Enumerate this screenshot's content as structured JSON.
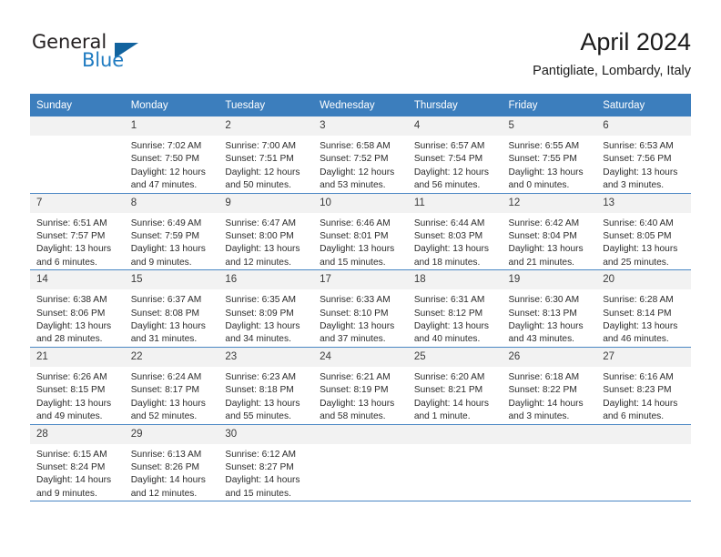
{
  "logo": {
    "word_one": "General",
    "word_two": "Blue",
    "triangle_color": "#12639e",
    "blue_color": "#1f7bc1"
  },
  "header": {
    "title": "April 2024",
    "subtitle": "Pantigliate, Lombardy, Italy"
  },
  "theme": {
    "header_blue": "#3c7ebd",
    "grid_line": "#4a87c4",
    "daynum_bg": "#f2f2f2"
  },
  "columns": [
    "Sunday",
    "Monday",
    "Tuesday",
    "Wednesday",
    "Thursday",
    "Friday",
    "Saturday"
  ],
  "weeks": [
    [
      {
        "day": "",
        "lines": []
      },
      {
        "day": "1",
        "lines": [
          "Sunrise: 7:02 AM",
          "Sunset: 7:50 PM",
          "Daylight: 12 hours",
          "and 47 minutes."
        ]
      },
      {
        "day": "2",
        "lines": [
          "Sunrise: 7:00 AM",
          "Sunset: 7:51 PM",
          "Daylight: 12 hours",
          "and 50 minutes."
        ]
      },
      {
        "day": "3",
        "lines": [
          "Sunrise: 6:58 AM",
          "Sunset: 7:52 PM",
          "Daylight: 12 hours",
          "and 53 minutes."
        ]
      },
      {
        "day": "4",
        "lines": [
          "Sunrise: 6:57 AM",
          "Sunset: 7:54 PM",
          "Daylight: 12 hours",
          "and 56 minutes."
        ]
      },
      {
        "day": "5",
        "lines": [
          "Sunrise: 6:55 AM",
          "Sunset: 7:55 PM",
          "Daylight: 13 hours",
          "and 0 minutes."
        ]
      },
      {
        "day": "6",
        "lines": [
          "Sunrise: 6:53 AM",
          "Sunset: 7:56 PM",
          "Daylight: 13 hours",
          "and 3 minutes."
        ]
      }
    ],
    [
      {
        "day": "7",
        "lines": [
          "Sunrise: 6:51 AM",
          "Sunset: 7:57 PM",
          "Daylight: 13 hours",
          "and 6 minutes."
        ]
      },
      {
        "day": "8",
        "lines": [
          "Sunrise: 6:49 AM",
          "Sunset: 7:59 PM",
          "Daylight: 13 hours",
          "and 9 minutes."
        ]
      },
      {
        "day": "9",
        "lines": [
          "Sunrise: 6:47 AM",
          "Sunset: 8:00 PM",
          "Daylight: 13 hours",
          "and 12 minutes."
        ]
      },
      {
        "day": "10",
        "lines": [
          "Sunrise: 6:46 AM",
          "Sunset: 8:01 PM",
          "Daylight: 13 hours",
          "and 15 minutes."
        ]
      },
      {
        "day": "11",
        "lines": [
          "Sunrise: 6:44 AM",
          "Sunset: 8:03 PM",
          "Daylight: 13 hours",
          "and 18 minutes."
        ]
      },
      {
        "day": "12",
        "lines": [
          "Sunrise: 6:42 AM",
          "Sunset: 8:04 PM",
          "Daylight: 13 hours",
          "and 21 minutes."
        ]
      },
      {
        "day": "13",
        "lines": [
          "Sunrise: 6:40 AM",
          "Sunset: 8:05 PM",
          "Daylight: 13 hours",
          "and 25 minutes."
        ]
      }
    ],
    [
      {
        "day": "14",
        "lines": [
          "Sunrise: 6:38 AM",
          "Sunset: 8:06 PM",
          "Daylight: 13 hours",
          "and 28 minutes."
        ]
      },
      {
        "day": "15",
        "lines": [
          "Sunrise: 6:37 AM",
          "Sunset: 8:08 PM",
          "Daylight: 13 hours",
          "and 31 minutes."
        ]
      },
      {
        "day": "16",
        "lines": [
          "Sunrise: 6:35 AM",
          "Sunset: 8:09 PM",
          "Daylight: 13 hours",
          "and 34 minutes."
        ]
      },
      {
        "day": "17",
        "lines": [
          "Sunrise: 6:33 AM",
          "Sunset: 8:10 PM",
          "Daylight: 13 hours",
          "and 37 minutes."
        ]
      },
      {
        "day": "18",
        "lines": [
          "Sunrise: 6:31 AM",
          "Sunset: 8:12 PM",
          "Daylight: 13 hours",
          "and 40 minutes."
        ]
      },
      {
        "day": "19",
        "lines": [
          "Sunrise: 6:30 AM",
          "Sunset: 8:13 PM",
          "Daylight: 13 hours",
          "and 43 minutes."
        ]
      },
      {
        "day": "20",
        "lines": [
          "Sunrise: 6:28 AM",
          "Sunset: 8:14 PM",
          "Daylight: 13 hours",
          "and 46 minutes."
        ]
      }
    ],
    [
      {
        "day": "21",
        "lines": [
          "Sunrise: 6:26 AM",
          "Sunset: 8:15 PM",
          "Daylight: 13 hours",
          "and 49 minutes."
        ]
      },
      {
        "day": "22",
        "lines": [
          "Sunrise: 6:24 AM",
          "Sunset: 8:17 PM",
          "Daylight: 13 hours",
          "and 52 minutes."
        ]
      },
      {
        "day": "23",
        "lines": [
          "Sunrise: 6:23 AM",
          "Sunset: 8:18 PM",
          "Daylight: 13 hours",
          "and 55 minutes."
        ]
      },
      {
        "day": "24",
        "lines": [
          "Sunrise: 6:21 AM",
          "Sunset: 8:19 PM",
          "Daylight: 13 hours",
          "and 58 minutes."
        ]
      },
      {
        "day": "25",
        "lines": [
          "Sunrise: 6:20 AM",
          "Sunset: 8:21 PM",
          "Daylight: 14 hours",
          "and 1 minute."
        ]
      },
      {
        "day": "26",
        "lines": [
          "Sunrise: 6:18 AM",
          "Sunset: 8:22 PM",
          "Daylight: 14 hours",
          "and 3 minutes."
        ]
      },
      {
        "day": "27",
        "lines": [
          "Sunrise: 6:16 AM",
          "Sunset: 8:23 PM",
          "Daylight: 14 hours",
          "and 6 minutes."
        ]
      }
    ],
    [
      {
        "day": "28",
        "lines": [
          "Sunrise: 6:15 AM",
          "Sunset: 8:24 PM",
          "Daylight: 14 hours",
          "and 9 minutes."
        ]
      },
      {
        "day": "29",
        "lines": [
          "Sunrise: 6:13 AM",
          "Sunset: 8:26 PM",
          "Daylight: 14 hours",
          "and 12 minutes."
        ]
      },
      {
        "day": "30",
        "lines": [
          "Sunrise: 6:12 AM",
          "Sunset: 8:27 PM",
          "Daylight: 14 hours",
          "and 15 minutes."
        ]
      },
      {
        "day": "",
        "lines": []
      },
      {
        "day": "",
        "lines": []
      },
      {
        "day": "",
        "lines": []
      },
      {
        "day": "",
        "lines": []
      }
    ]
  ]
}
